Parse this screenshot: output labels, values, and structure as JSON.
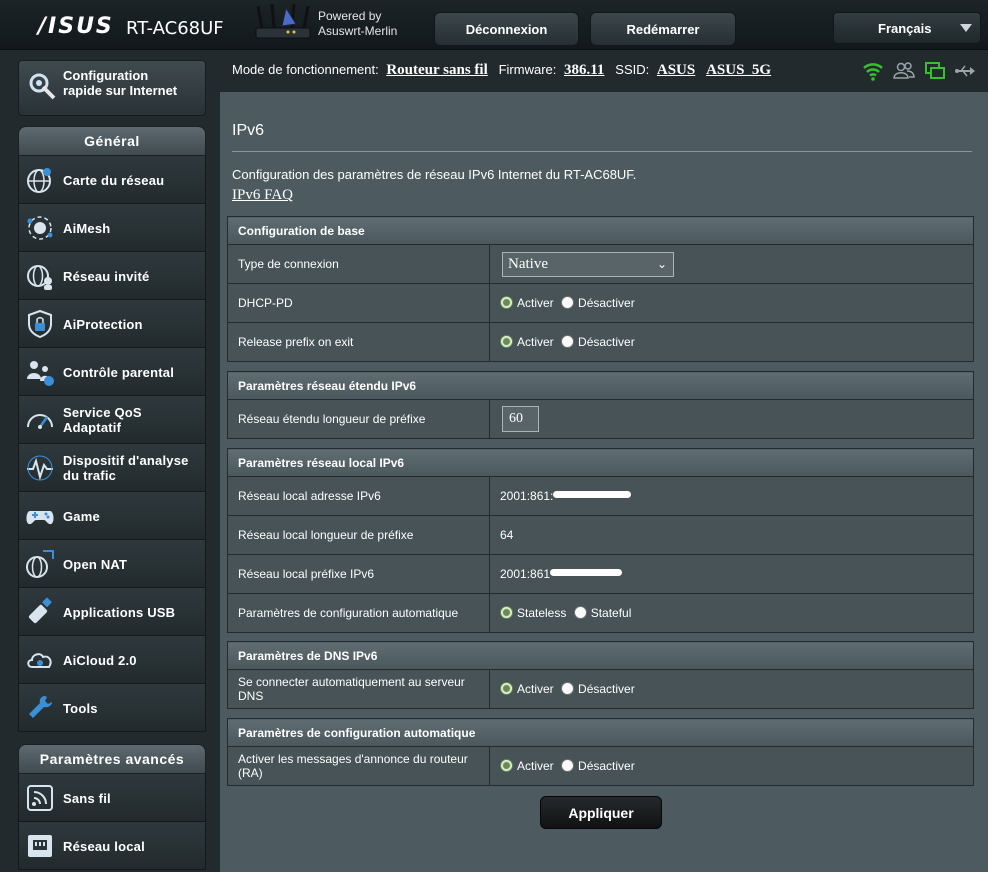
{
  "header": {
    "brand": "/ISUS",
    "model": "RT-AC68UF",
    "powered_by_line1": "Powered by",
    "powered_by_line2": "Asuswrt-Merlin",
    "logout_label": "Déconnexion",
    "reboot_label": "Redémarrer",
    "language": "Français"
  },
  "sidebar": {
    "quick_setup_label": "Configuration\nrapide sur Internet",
    "general_title": "Général",
    "general_items": [
      {
        "label": "Carte du réseau",
        "icon": "network-map-icon"
      },
      {
        "label": "AiMesh",
        "icon": "aimesh-icon"
      },
      {
        "label": "Réseau invité",
        "icon": "guest-network-icon"
      },
      {
        "label": "AiProtection",
        "icon": "shield-lock-icon"
      },
      {
        "label": "Contrôle parental",
        "icon": "parental-control-icon"
      },
      {
        "label": "Service QoS\nAdaptatif",
        "icon": "speedometer-icon"
      },
      {
        "label": "Dispositif d'analyse\ndu trafic",
        "icon": "traffic-analyzer-icon"
      },
      {
        "label": "Game",
        "icon": "gamepad-icon"
      },
      {
        "label": "Open NAT",
        "icon": "open-nat-icon"
      },
      {
        "label": "Applications USB",
        "icon": "usb-stick-icon"
      },
      {
        "label": "AiCloud 2.0",
        "icon": "cloud-icon"
      },
      {
        "label": "Tools",
        "icon": "wrench-icon"
      }
    ],
    "advanced_title": "Paramètres avancés",
    "advanced_items": [
      {
        "label": "Sans fil",
        "icon": "wireless-icon"
      },
      {
        "label": "Réseau local",
        "icon": "lan-icon"
      }
    ]
  },
  "status": {
    "mode_label": "Mode de fonctionnement:",
    "mode_value": "Routeur sans fil",
    "firmware_label": "Firmware:",
    "firmware_value": "386.11",
    "ssid_label": "SSID:",
    "ssid_1": "ASUS",
    "ssid_2": "ASUS_5G",
    "icons": [
      "wifi-icon",
      "users-icon",
      "devices-icon",
      "usb-icon"
    ],
    "accent_color": "#38c12f"
  },
  "main": {
    "title": "IPv6",
    "description": "Configuration des paramètres de réseau IPv6 Internet du RT-AC68UF.",
    "faq_link": "IPv6 FAQ",
    "basic": {
      "title": "Configuration de base",
      "connection_type_label": "Type de connexion",
      "connection_type_value": "Native",
      "dhcp_pd_label": "DHCP-PD",
      "release_prefix_label": "Release prefix on exit"
    },
    "radio": {
      "enable": "Activer",
      "disable": "Désactiver"
    },
    "wan": {
      "title": "Paramètres réseau étendu IPv6",
      "prefix_length_label": "Réseau étendu longueur de préfixe",
      "prefix_length_value": "60"
    },
    "lan": {
      "title": "Paramètres réseau local IPv6",
      "address_label": "Réseau local adresse IPv6",
      "address_value": "2001:861:",
      "prefix_length_label": "Réseau local longueur de préfixe",
      "prefix_length_value": "64",
      "prefix_label": "Réseau local préfixe IPv6",
      "prefix_value": "2001:861",
      "autoconf_label": "Paramètres de configuration automatique",
      "stateless": "Stateless",
      "stateful": "Stateful"
    },
    "dns": {
      "title": "Paramètres de DNS IPv6",
      "auto_dns_label": "Se connecter automatiquement au serveur DNS"
    },
    "autoconf": {
      "title": "Paramètres de configuration automatique",
      "ra_label": "Activer les messages d'annonce du routeur (RA)"
    },
    "apply_label": "Appliquer"
  }
}
